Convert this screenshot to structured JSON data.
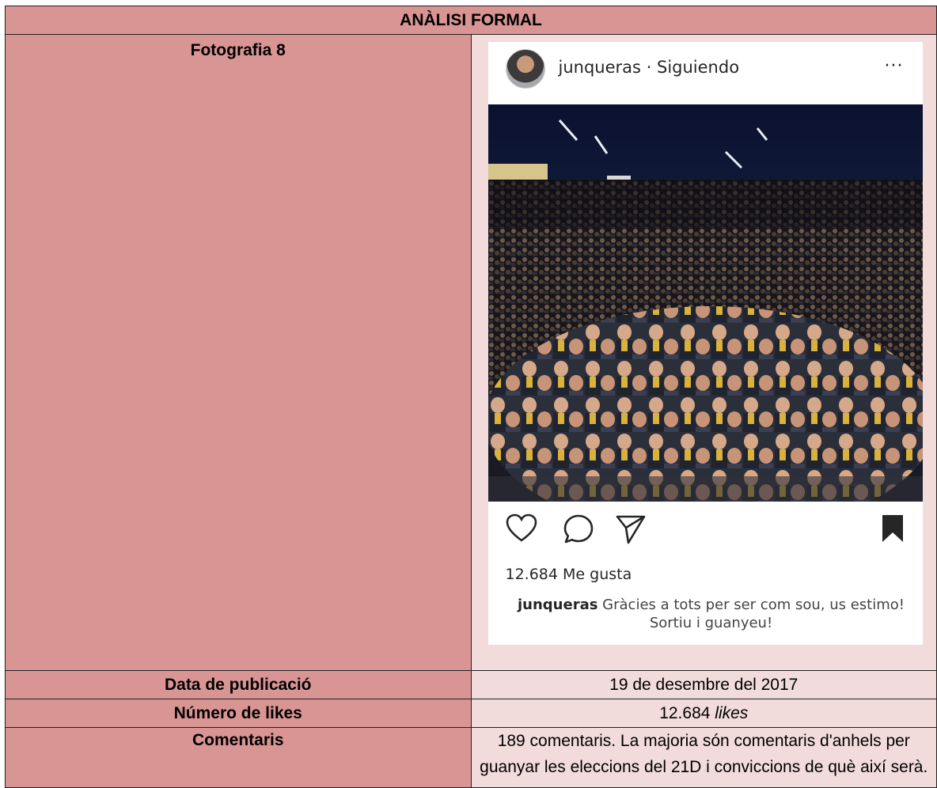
{
  "header": {
    "title": "ANÀLISI FORMAL"
  },
  "rows": {
    "photo_label": "Fotografia 8",
    "date_label": "Data de publicació",
    "date_value": "19 de desembre del 2017",
    "likes_label": "Número de likes",
    "likes_value_number": "12.684",
    "likes_value_word": "likes",
    "comments_label": "Comentaris",
    "comments_value": "189 comentaris. La majoria són comentaris d'anhels per guanyar les eleccions del 21D i conviccions de què així serà."
  },
  "instagram": {
    "username": "junqueras",
    "separator": " · ",
    "follow_status": "Siguiendo",
    "more": "···",
    "likes": "12.684 Me gusta",
    "caption_user": "junqueras",
    "caption_text": "Gràcies a tots per ser com sou, us estimo! Sortiu i guanyeu!"
  },
  "colors": {
    "label_bg": "#d99594",
    "value_bg": "#f2dcdb"
  }
}
